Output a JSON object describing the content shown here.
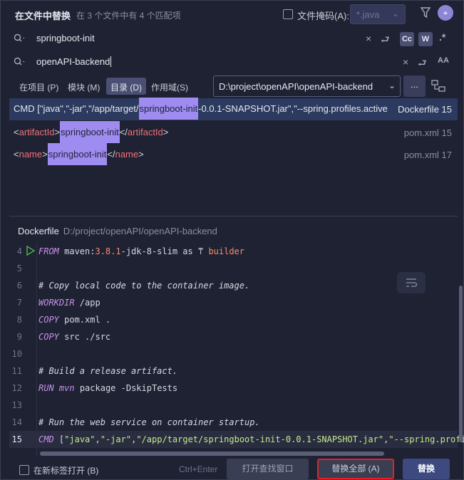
{
  "header": {
    "title": "在文件中替换",
    "summary": "在 3 个文件中有 4 个匹配项",
    "file_mask_label": "文件掩码(A):",
    "file_mask_value": "*.java"
  },
  "search": {
    "find_value": "springboot-init",
    "replace_value": "openAPI-backend",
    "opt_case": "Cc",
    "opt_word": "W",
    "opt_regex": ".*"
  },
  "scope": {
    "tabs": [
      "在项目 (P)",
      "模块 (M)",
      "目录 (D)",
      "作用域(S)"
    ],
    "active_tab": "目录 (D)",
    "directory": "D:\\project\\openAPI\\openAPI-backend",
    "more_label": "..."
  },
  "results": [
    {
      "pre": "CMD [\"java\",\"-jar\",\"/app/target/",
      "match": "springboot-init",
      "post": "-0.0.1-SNAPSHOT.jar\",\"--spring.profiles.active",
      "file": "Dockerfile 15"
    },
    {
      "open_tag": "artifactId",
      "match": "springboot-init",
      "file": "pom.xml 15"
    },
    {
      "open_tag": "name",
      "match": "springboot-init",
      "file": "pom.xml 17"
    }
  ],
  "preview": {
    "file_name": "Dockerfile",
    "file_path": "D:/project/openAPI/openAPI-backend",
    "lines": [
      {
        "n": "4",
        "kw": "FROM",
        "a": " maven:",
        "b": "3.8.1",
        "c": "-jdk-8-slim as ",
        "d": "builder"
      },
      {
        "n": "5"
      },
      {
        "n": "6",
        "comment": "# Copy local code to the container image."
      },
      {
        "n": "7",
        "kw": "WORKDIR",
        "rest": " /app"
      },
      {
        "n": "8",
        "kw": "COPY",
        "rest": " pom.xml ."
      },
      {
        "n": "9",
        "kw": "COPY",
        "rest": " src ./src"
      },
      {
        "n": "10"
      },
      {
        "n": "11",
        "comment": "# Build a release artifact."
      },
      {
        "n": "12",
        "kw": "RUN",
        "kw2": " mvn",
        "rest": " package -DskipTests"
      },
      {
        "n": "13"
      },
      {
        "n": "14",
        "comment": "# Run the web service on container startup."
      },
      {
        "n": "15",
        "kw": "CMD",
        "rest": " [",
        "s1": "\"java\"",
        "c1": ",",
        "s2": "\"-jar\"",
        "c2": ",",
        "s3": "\"/app/target/springboot-init-0.0.1-SNAPSHOT.jar\"",
        "c3": ",",
        "s4": "\"--spring.profil"
      }
    ]
  },
  "footer": {
    "open_in_new_tab": "在新标签打开 (B)",
    "shortcut": "Ctrl+Enter",
    "open_find_window": "打开查找窗口",
    "replace_all": "替换全部 (A)",
    "replace": "替换"
  },
  "colors": {
    "highlight": "#9f8cf1",
    "accent_button": "#3d4a80",
    "focus_border": "#e0222a"
  }
}
